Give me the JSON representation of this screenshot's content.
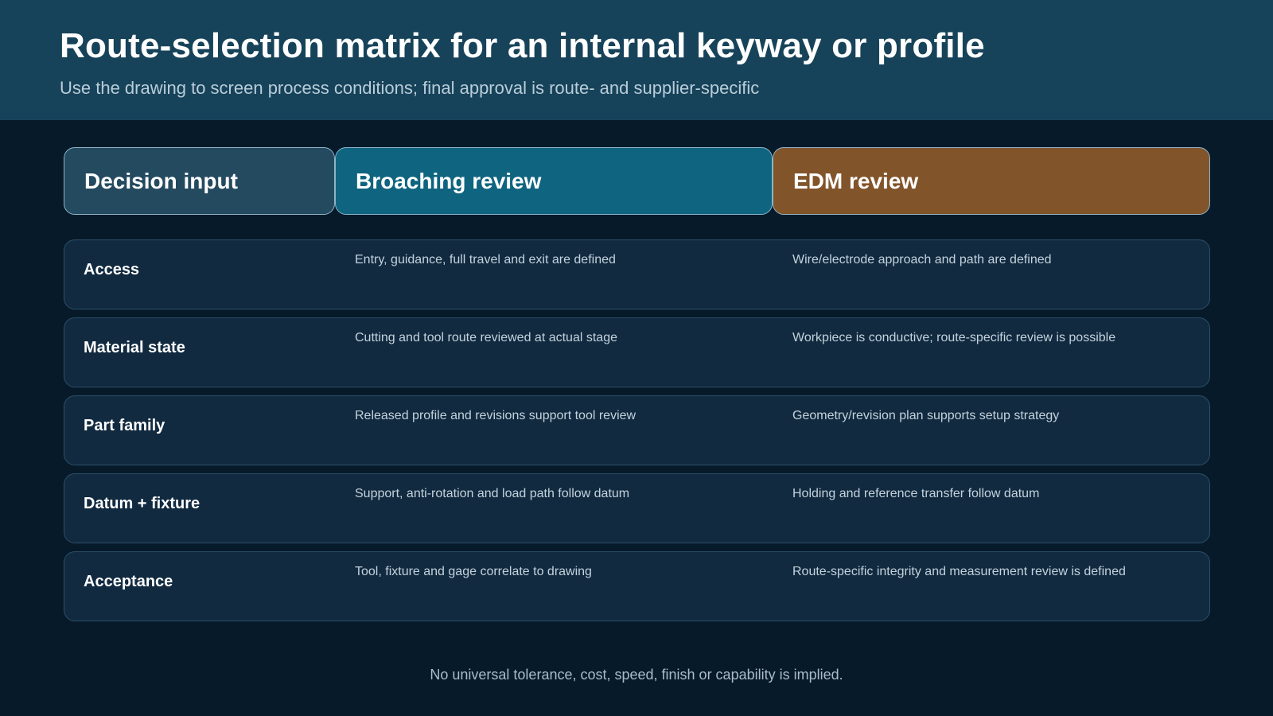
{
  "header": {
    "title": "Route-selection matrix for an internal keyway or profile",
    "subtitle": "Use the drawing to screen process conditions; final approval is route- and supplier-specific"
  },
  "columns": {
    "decision": "Decision input",
    "broaching": "Broaching review",
    "edm": "EDM review"
  },
  "colors": {
    "page_background": "#071a29",
    "header_band": "#17435a",
    "decision_header": "#244a60",
    "broaching_header": "#0f6480",
    "edm_header": "#82542a",
    "row_background": "#112a40"
  },
  "rows": [
    {
      "label": "Access",
      "broaching": "Entry, guidance, full travel and exit are defined",
      "edm": "Wire/electrode approach and path are defined"
    },
    {
      "label": "Material state",
      "broaching": "Cutting and tool route reviewed at actual stage",
      "edm": "Workpiece is conductive; route-specific review is possible"
    },
    {
      "label": "Part family",
      "broaching": "Released profile and revisions support tool review",
      "edm": "Geometry/revision plan supports setup strategy"
    },
    {
      "label": "Datum + fixture",
      "broaching": "Support, anti-rotation and load path follow datum",
      "edm": "Holding and reference transfer follow datum"
    },
    {
      "label": "Acceptance",
      "broaching": "Tool, fixture and gage correlate to drawing",
      "edm": "Route-specific integrity and measurement review is defined"
    }
  ],
  "footnote": "No universal tolerance, cost, speed, finish or capability is implied."
}
